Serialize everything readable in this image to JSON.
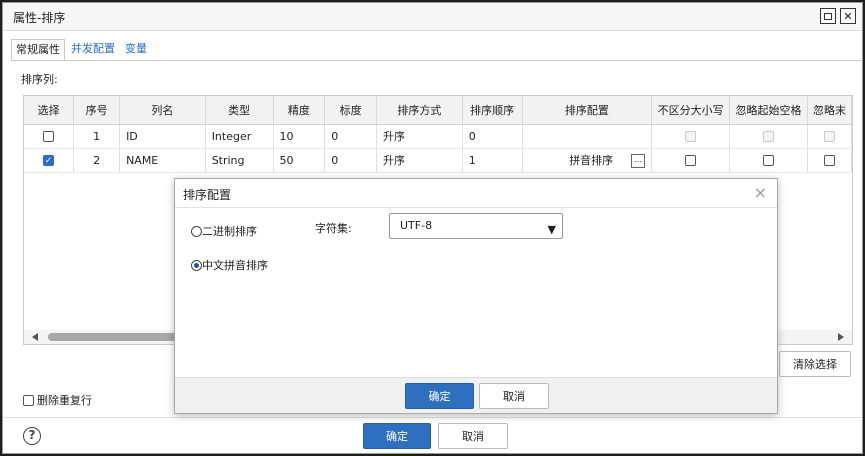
{
  "window": {
    "title": "属性-排序",
    "maximize_icon": "maximize-icon",
    "close_icon": "close-icon"
  },
  "tabs": [
    {
      "label": "常规属性",
      "active": true
    },
    {
      "label": "并发配置",
      "active": false
    },
    {
      "label": "变量",
      "active": false
    }
  ],
  "sort_columns_label": "排序列:",
  "table": {
    "headers": [
      "选择",
      "序号",
      "列名",
      "类型",
      "精度",
      "标度",
      "排序方式",
      "排序顺序",
      "排序配置",
      "不区分大小写",
      "忽略起始空格",
      "忽略末"
    ],
    "rows": [
      {
        "selected": false,
        "index": "1",
        "name": "ID",
        "type": "Integer",
        "precision": "10",
        "scale": "0",
        "sort_method": "升序",
        "sort_order": "0",
        "sort_config": "",
        "case_insensitive": false,
        "ignore_leading": false,
        "disabled": true
      },
      {
        "selected": true,
        "index": "2",
        "name": "NAME",
        "type": "String",
        "precision": "50",
        "scale": "0",
        "sort_method": "升序",
        "sort_order": "1",
        "sort_config": "拼音排序",
        "config_button": "...",
        "case_insensitive": false,
        "ignore_leading": false,
        "disabled": false
      }
    ]
  },
  "clear_selection_label": "清除选择",
  "remove_duplicates_label": "删除重复行",
  "footer": {
    "ok_label": "确定",
    "cancel_label": "取消"
  },
  "sort_config_dialog": {
    "title": "排序配置",
    "close_glyph": "×",
    "options": [
      {
        "label": "二进制排序",
        "selected": false
      },
      {
        "label": "中文拼音排序",
        "selected": true
      }
    ],
    "charset_label": "字符集:",
    "charset_value": "UTF-8",
    "ok_label": "确定",
    "cancel_label": "取消"
  },
  "colors": {
    "primary": "#2f6fbf",
    "link": "#2a6cc6"
  }
}
